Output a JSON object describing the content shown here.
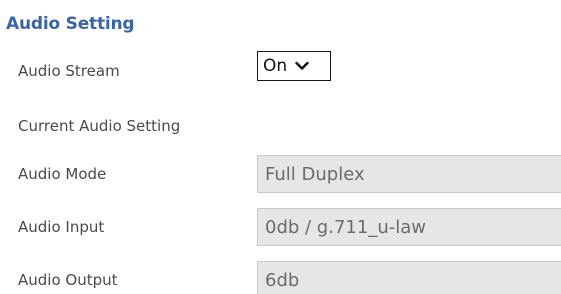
{
  "section": {
    "title": "Audio Setting"
  },
  "audio_stream": {
    "label": "Audio Stream",
    "selected": "On",
    "icon": "chevron-down-icon"
  },
  "current_setting": {
    "label": "Current Audio Setting"
  },
  "audio_mode": {
    "label": "Audio Mode",
    "value": "Full Duplex"
  },
  "audio_input": {
    "label": "Audio Input",
    "value": "0db / g.711_u-law"
  },
  "audio_output": {
    "label": "Audio Output",
    "value": "6db"
  },
  "colors": {
    "title": "#3a64a8",
    "label": "#4a4a4a",
    "field_bg": "#e6e6e6",
    "field_text": "#6b6b6b"
  }
}
